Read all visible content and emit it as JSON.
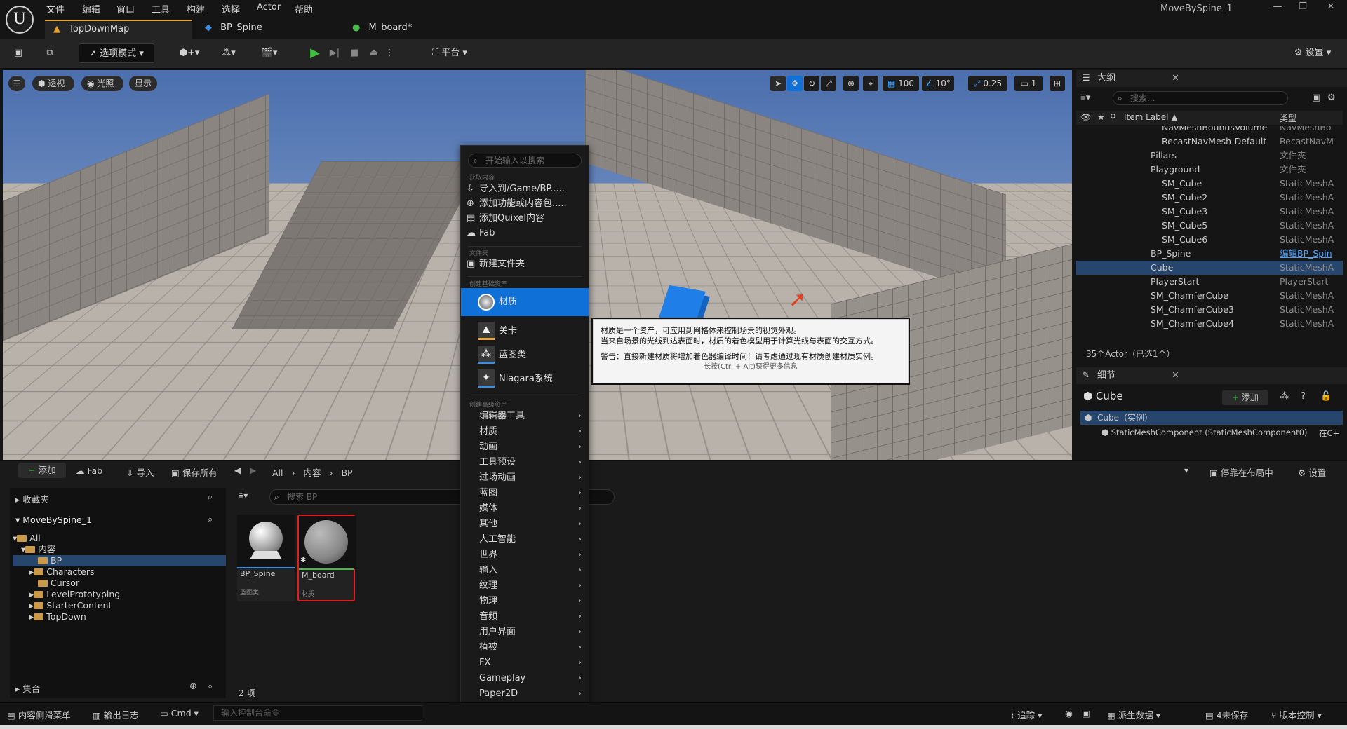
{
  "menu": [
    "文件",
    "编辑",
    "窗口",
    "工具",
    "构建",
    "选择",
    "Actor",
    "帮助"
  ],
  "tabs": [
    {
      "label": "TopDownMap"
    },
    {
      "label": "BP_Spine"
    },
    {
      "label": "M_board*"
    }
  ],
  "window_title": "MoveBySpine_1",
  "toolbar": {
    "mode": "选项模式",
    "platform": "平台",
    "settings": "设置"
  },
  "viewport": {
    "perspective": "透视",
    "lighting": "光照",
    "show": "显示",
    "grid_snap": "100",
    "rot_snap": "10°",
    "scale_snap": "0.25",
    "camera_speed": "1"
  },
  "outliner": {
    "title": "大纲",
    "search_placeholder": "搜索...",
    "col_label": "Item Label ▲",
    "col_type": "类型",
    "rows": [
      {
        "label": "NavMeshBoundsVolume",
        "type": "NavMeshBo"
      },
      {
        "label": "RecastNavMesh-Default",
        "type": "RecastNavM"
      },
      {
        "label": "Pillars",
        "type": "文件夹"
      },
      {
        "label": "Playground",
        "type": "文件夹"
      },
      {
        "label": "SM_Cube",
        "type": "StaticMeshA"
      },
      {
        "label": "SM_Cube2",
        "type": "StaticMeshA"
      },
      {
        "label": "SM_Cube3",
        "type": "StaticMeshA"
      },
      {
        "label": "SM_Cube5",
        "type": "StaticMeshA"
      },
      {
        "label": "SM_Cube6",
        "type": "StaticMeshA"
      },
      {
        "label": "BP_Spine",
        "type": "编辑BP_Spin"
      },
      {
        "label": "Cube",
        "type": "StaticMeshA"
      },
      {
        "label": "PlayerStart",
        "type": "PlayerStart"
      },
      {
        "label": "SM_ChamferCube",
        "type": "StaticMeshA"
      },
      {
        "label": "SM_ChamferCube3",
        "type": "StaticMeshA"
      },
      {
        "label": "SM_ChamferCube4",
        "type": "StaticMeshA"
      }
    ],
    "count": "35个Actor（已选1个）"
  },
  "details": {
    "title": "细节",
    "object": "Cube",
    "add": "添加",
    "instance": "Cube（实例）",
    "component": "StaticMeshComponent (StaticMeshComponent0)",
    "component_link": "在C+"
  },
  "content_browser": {
    "add": "添加",
    "fab": "Fab",
    "import": "导入",
    "save_all": "保存所有",
    "breadcrumb": [
      "All",
      "内容",
      "BP"
    ],
    "dock": "停靠在布局中",
    "settings": "设置",
    "favorites": "收藏夹",
    "project": "MoveBySpine_1",
    "tree": [
      "All",
      "内容",
      "BP",
      "Characters",
      "Cursor",
      "LevelPrototyping",
      "StarterContent",
      "TopDown"
    ],
    "collections": "集合",
    "search_placeholder": "搜索 BP",
    "assets": [
      {
        "name": "BP_Spine",
        "kind": "蓝图类"
      },
      {
        "name": "M_board",
        "kind": "材质"
      }
    ],
    "item_count": "2 项"
  },
  "context_menu": {
    "search_placeholder": "开始输入以搜索",
    "sec_get": "获取内容",
    "get_items": [
      "导入到/Game/BP.....",
      "添加功能或内容包.....",
      "添加Quixel内容",
      "Fab"
    ],
    "sec_folder": "文件夹",
    "new_folder": "新建文件夹",
    "sec_basic": "创建基础资产",
    "basic": [
      "材质",
      "关卡",
      "蓝图类",
      "Niagara系统"
    ],
    "sec_advanced": "创建高级资产",
    "advanced": [
      "编辑器工具",
      "材质",
      "动画",
      "工具预设",
      "过场动画",
      "蓝图",
      "媒体",
      "其他",
      "人工智能",
      "世界",
      "输入",
      "纹理",
      "物理",
      "音频",
      "用户界面",
      "植被",
      "FX",
      "Gameplay",
      "Paper2D"
    ]
  },
  "tooltip": {
    "line1": "材质是一个资产，可应用到网格体来控制场景的视觉外观。",
    "line2": "当来自场景的光线到达表面时，材质的着色模型用于计算光线与表面的交互方式。",
    "warning": "警告：直接新建材质将增加着色器编译时间！请考虑通过现有材质创建材质实例。",
    "hint": "长按(Ctrl + Alt)获得更多信息"
  },
  "statusbar": {
    "content_drawer": "内容侧滑菜单",
    "output_log": "输出日志",
    "cmd": "Cmd",
    "console_placeholder": "输入控制台命令",
    "trace": "追踪",
    "derived_data": "派生数据",
    "unsaved": "4未保存",
    "source_control": "版本控制"
  },
  "colors": {
    "accent_blue": "#0f70d8",
    "selection": "#26466e",
    "play_green": "#40c040",
    "tab_accent": "#e3a12e",
    "highlight_red": "#e02020"
  }
}
